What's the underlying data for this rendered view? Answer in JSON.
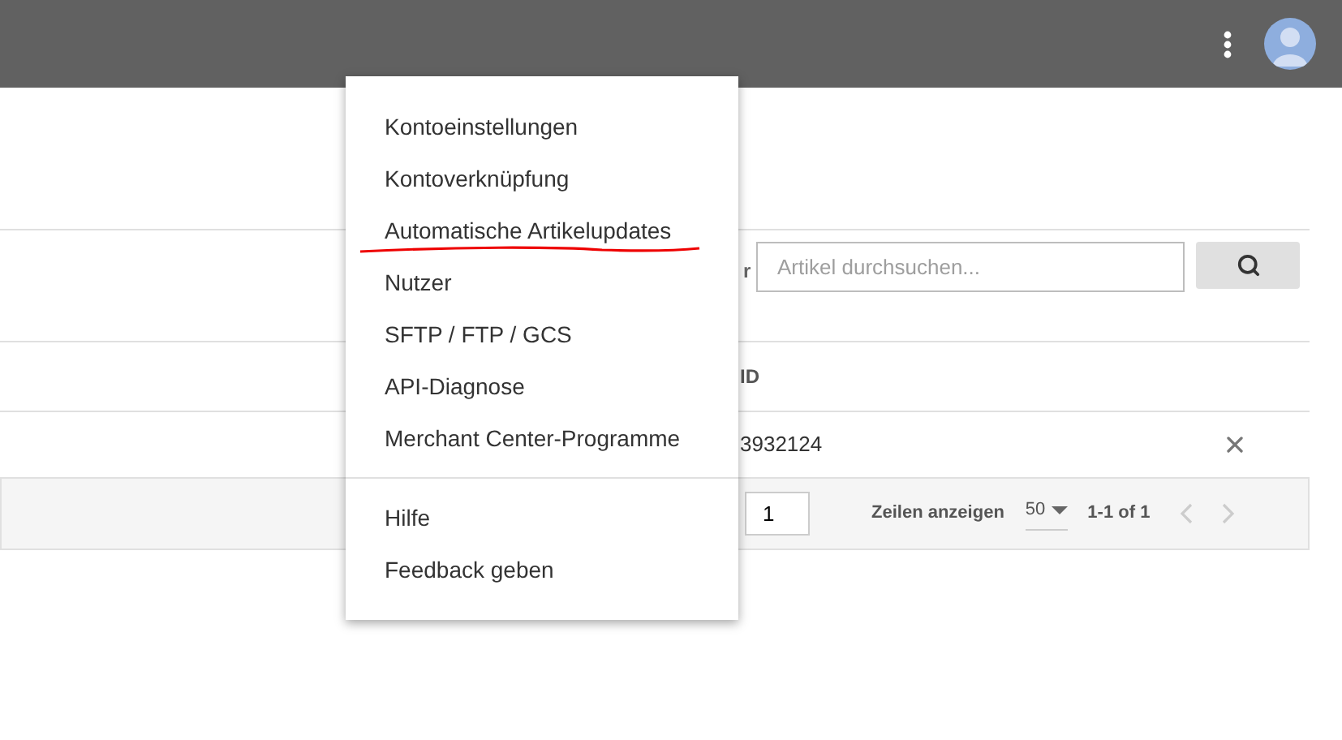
{
  "menu": {
    "groups": [
      {
        "items": [
          {
            "label": "Kontoeinstellungen",
            "underlined": false
          },
          {
            "label": "Kontoverknüpfung",
            "underlined": false
          },
          {
            "label": "Automatische Artikelupdates",
            "underlined": true
          },
          {
            "label": "Nutzer",
            "underlined": false
          },
          {
            "label": "SFTP / FTP / GCS",
            "underlined": false
          },
          {
            "label": "API-Diagnose",
            "underlined": false
          },
          {
            "label": "Merchant Center-Programme",
            "underlined": false
          }
        ]
      },
      {
        "items": [
          {
            "label": "Hilfe",
            "underlined": false
          },
          {
            "label": "Feedback geben",
            "underlined": false
          }
        ]
      }
    ]
  },
  "search": {
    "label_fragment": "r",
    "placeholder": "Artikel durchsuchen..."
  },
  "table": {
    "column_fragment": "ID",
    "rows": [
      {
        "id_fragment": "3932124"
      }
    ]
  },
  "pagination": {
    "page": "1",
    "rows_label": "Zeilen anzeigen",
    "rows_per_page": "50",
    "range": "1-1 of 1"
  }
}
